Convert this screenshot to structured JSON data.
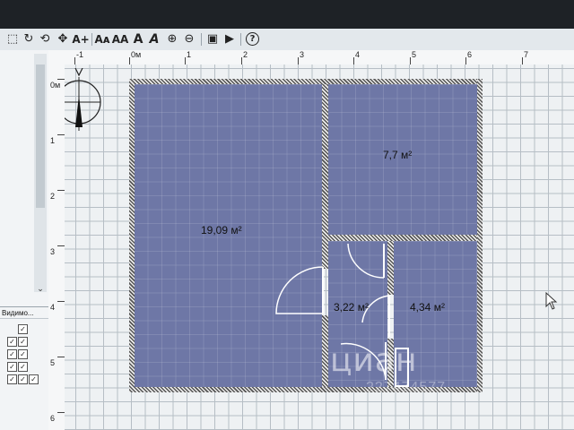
{
  "toolbar": {
    "buttons": [
      {
        "name": "select-icon",
        "glyph": "⬚"
      },
      {
        "name": "pan-icon",
        "glyph": "↻"
      },
      {
        "name": "create-walls-icon",
        "glyph": "⟲"
      },
      {
        "name": "create-rooms-icon",
        "glyph": "✥"
      },
      {
        "name": "add-text-icon",
        "glyph": "A+"
      },
      {
        "name": "dimension-icon",
        "glyph": "Aᴀ"
      },
      {
        "name": "increase-text-icon",
        "glyph": "AA"
      },
      {
        "name": "bold-text-icon",
        "glyph": "A"
      },
      {
        "name": "italic-text-icon",
        "glyph": "A"
      },
      {
        "name": "zoom-in-icon",
        "glyph": "⊕"
      },
      {
        "name": "zoom-out-icon",
        "glyph": "⊖"
      },
      {
        "name": "photo-icon",
        "glyph": "▣"
      },
      {
        "name": "video-icon",
        "glyph": "▶"
      },
      {
        "name": "help-icon",
        "glyph": "?"
      }
    ]
  },
  "left_panel": {
    "visibility_header": "Видимо...",
    "checks": [
      "✓",
      "✓",
      "✓",
      "✓",
      "✓",
      "✓",
      "✓",
      "✓",
      "✓",
      "✓"
    ]
  },
  "ruler": {
    "top_labels": [
      "-1",
      "0м",
      "1",
      "2",
      "3",
      "4",
      "5",
      "6",
      "7"
    ],
    "left_labels": [
      "0м",
      "1",
      "2",
      "3",
      "4",
      "5",
      "6"
    ]
  },
  "plan": {
    "rooms": [
      {
        "id": "living",
        "area": "19,09 м²"
      },
      {
        "id": "kitchen",
        "area": "7,7 м²"
      },
      {
        "id": "hall",
        "area": "3,22 м²"
      },
      {
        "id": "bath",
        "area": "4,34 м²"
      }
    ]
  },
  "watermark": {
    "brand": "циан",
    "id": "227474577"
  },
  "colors": {
    "room_fill": "#6e77a6",
    "grid": "#b6bec5",
    "wall": "#6f6f6f"
  }
}
